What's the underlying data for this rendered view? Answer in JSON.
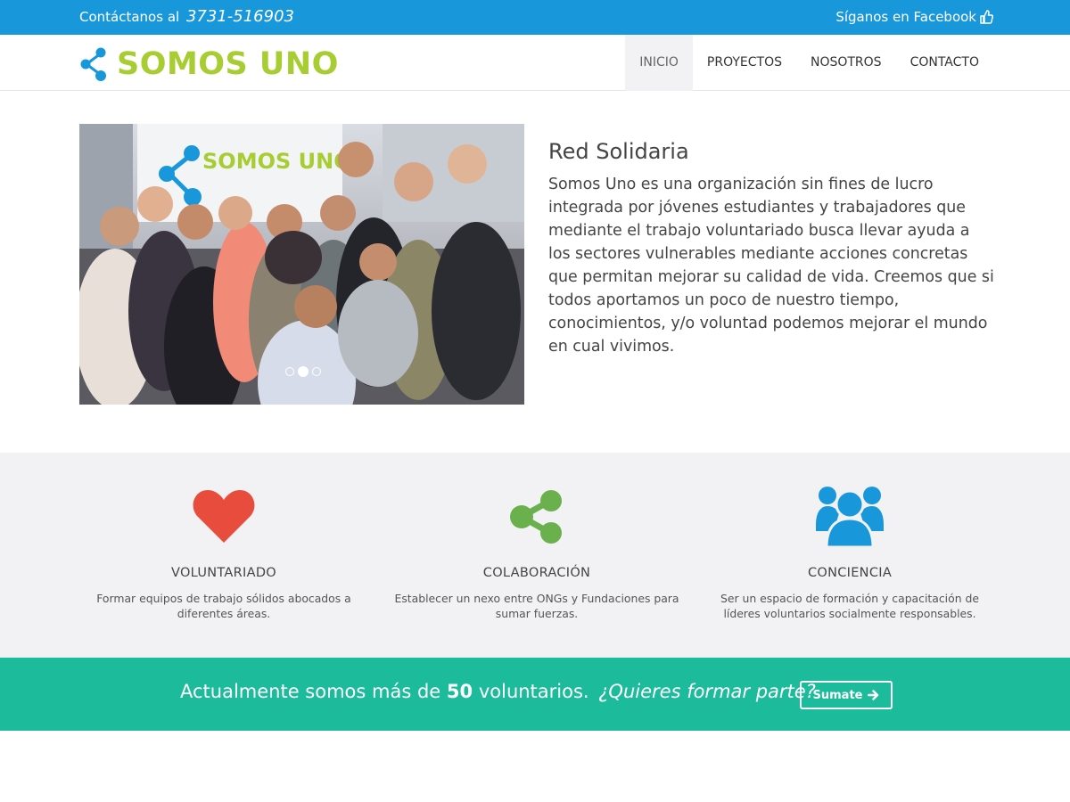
{
  "topbar": {
    "contact_label": "Contáctanos al",
    "phone": "3731-516903",
    "facebook_label": "Síganos en Facebook"
  },
  "brand": {
    "name": "SOMOS UNO"
  },
  "nav": {
    "items": [
      {
        "label": "INICIO"
      },
      {
        "label": "PROYECTOS"
      },
      {
        "label": "NOSOTROS"
      },
      {
        "label": "CONTACTO"
      }
    ]
  },
  "hero": {
    "banner_text": "SOMOS UNO",
    "slides_total": 3,
    "active_slide": 2
  },
  "intro": {
    "title": "Red Solidaria",
    "body": "Somos Uno es una organización sin fines de lucro integrada por jóvenes estudiantes y trabajadores que mediante el trabajo voluntariado busca llevar ayuda a los sectores vulnerables mediante acciones concretas que permitan mejorar su calidad de vida. Creemos que si todos aportamos un poco de nuestro tiempo, conocimientos, y/o voluntad podemos mejorar el mundo en cual vivimos."
  },
  "features": [
    {
      "icon": "heart-icon",
      "title": "VOLUNTARIADO",
      "text": "Formar equipos de trabajo sólidos abocados a diferentes áreas."
    },
    {
      "icon": "share-icon",
      "title": "COLABORACIÓN",
      "text": "Establecer un nexo entre ONGs y Fundaciones para sumar fuerzas."
    },
    {
      "icon": "users-icon",
      "title": "CONCIENCIA",
      "text": "Ser un espacio de formación y capacitación de líderes voluntarios socialmente responsables."
    }
  ],
  "cta": {
    "text_before": "Actualmente somos más de",
    "count": "50",
    "text_after": "voluntarios.",
    "question": "¿Quieres formar parte?",
    "button_label": "Sumate"
  },
  "colors": {
    "topbar": "#1997db",
    "brand_green": "#a8cd32",
    "brand_blue": "#1997db",
    "heart": "#e84c3d",
    "share": "#6ab04c",
    "users": "#1997db",
    "cta_bg": "#1cbb9b"
  }
}
